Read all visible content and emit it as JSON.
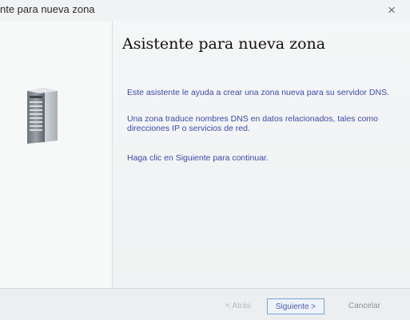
{
  "window": {
    "title": "nte para nueva zona",
    "close_glyph": "×"
  },
  "content": {
    "heading": "Asistente para nueva zona",
    "para1": "Este asistente le ayuda a crear una zona nueva para su servidor DNS.",
    "para2": "Una zona traduce nombres DNS en datos relacionados, tales como direcciones IP o servicios de red.",
    "para3": "Haga clic en Siguiente para continuar."
  },
  "buttons": {
    "back": "< Atrás",
    "next": "Siguiente >",
    "cancel": "Cancelar"
  },
  "icons": {
    "close": "close-icon",
    "server": "server-icon"
  }
}
